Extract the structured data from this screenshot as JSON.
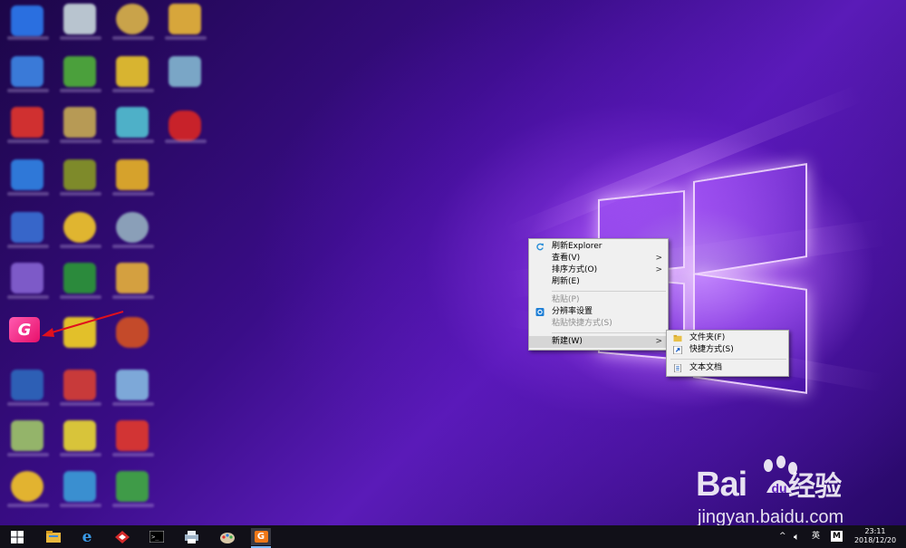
{
  "context_menu": {
    "items": [
      {
        "label": "刷新Explorer",
        "icon": "refresh-icon",
        "disabled": false,
        "submenu": false
      },
      {
        "label": "查看(V)",
        "disabled": false,
        "submenu": true
      },
      {
        "label": "排序方式(O)",
        "disabled": false,
        "submenu": true
      },
      {
        "label": "刷新(E)",
        "disabled": false,
        "submenu": false
      },
      {
        "label": "粘贴(P)",
        "disabled": true,
        "submenu": false
      },
      {
        "label": "分辨率设置",
        "icon": "display-settings-icon",
        "disabled": false,
        "submenu": false
      },
      {
        "label": "粘贴快捷方式(S)",
        "disabled": true,
        "submenu": false
      },
      {
        "label": "新建(W)",
        "disabled": false,
        "submenu": true,
        "highlighted": true
      }
    ]
  },
  "submenu_new": {
    "items": [
      {
        "label": "文件夹(F)",
        "icon": "folder-icon"
      },
      {
        "label": "快捷方式(S)",
        "icon": "shortcut-icon"
      },
      {
        "label": "文本文档",
        "icon": "text-document-icon"
      }
    ]
  },
  "taskbar": {
    "pinned": [
      "windows-start-icon",
      "file-explorer-icon",
      "edge-icon",
      "app-red-icon",
      "cmd-icon",
      "printer-app-icon",
      "paint-icon",
      "game-g-icon"
    ],
    "tray": {
      "chevron": "^",
      "ime": "英",
      "m_label": "M",
      "time": "23:11",
      "date": "2018/12/20"
    }
  },
  "watermark": {
    "brand": "Bai",
    "brand2": "经验",
    "url": "jingyan.baidu.com"
  },
  "colors": {
    "accent_purple": "#6a1fd0",
    "menu_bg": "#f0f0f0",
    "arrow_red": "#e0101c",
    "g_icon_pink": "#ff2d8a"
  }
}
